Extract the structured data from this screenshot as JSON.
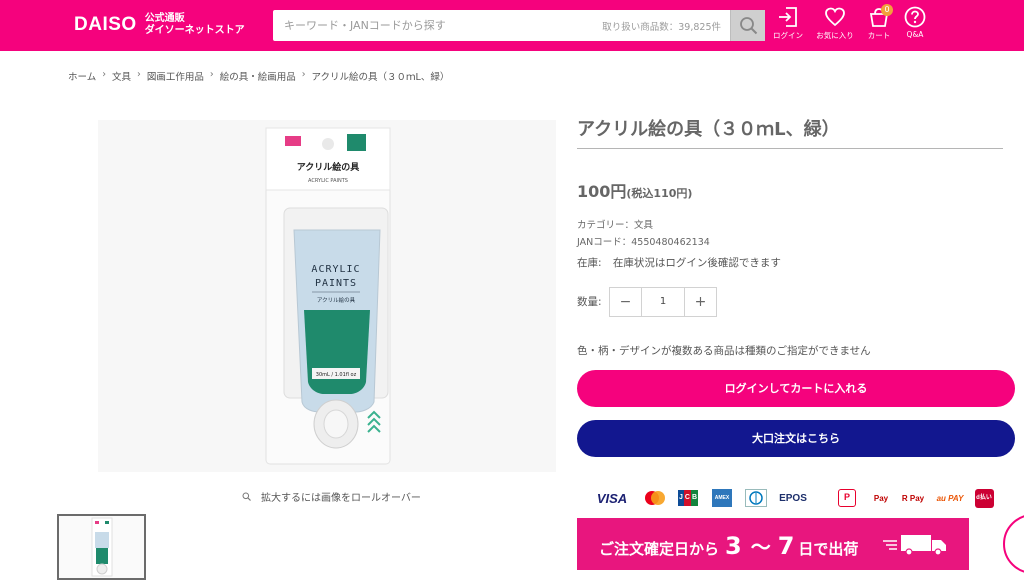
{
  "header": {
    "logo_text": "DAISO",
    "logo_sub_line1": "公式通販",
    "logo_sub_line2": "ダイソーネットストア",
    "search_placeholder": "キーワード・JANコードから探す",
    "search_count": "取り扱い商品数：39,825件",
    "nav": {
      "login": "ログイン",
      "favorites": "お気に入り",
      "cart": "カート",
      "cart_count": "0",
      "qa": "Q&A"
    },
    "brand_color": "#f5027d"
  },
  "breadcrumb": [
    "ホーム",
    "文具",
    "図画工作用品",
    "絵の具・絵画用品",
    "アクリル絵の具（３０ｍL、緑）"
  ],
  "gallery": {
    "zoom_hint": "拡大するには画像をロールオーバー"
  },
  "product": {
    "title": "アクリル絵の具（３０ｍL、緑）",
    "price": "100円",
    "price_tax": "(税込110円)",
    "category": "カテゴリー：文具",
    "jan": "JANコード：4550480462134",
    "stock_label": "在庫:",
    "stock_text": "在庫状況はログイン後確認できます",
    "quantity_label": "数量:",
    "quantity": "1",
    "note": "色・柄・デザインが複数ある商品は種類のご指定ができません",
    "cart_button": "ログインしてカートに入れる",
    "bulk_button": "大口注文はこちら",
    "bulk_color": "#12178f"
  },
  "package": {
    "header_title": "アクリル絵の具",
    "header_sub": "ACRYLIC PAINTS",
    "tube_line1": "ACRYLIC",
    "tube_line2": "PAINTS",
    "tube_jp": "アクリル絵の具",
    "tube_volume": "30mL / 1.01fl oz",
    "paint_color": "#1f8a6c"
  },
  "payments": [
    "VISA",
    "mastercard",
    "JCB",
    "AMEX",
    "Diners",
    "EPOS",
    "PayPay",
    "Pay",
    "R Pay",
    "au PAY",
    "d払い"
  ],
  "banner": {
    "prefix": "ご注文確定日から",
    "num1": "3",
    "tilde": "〜",
    "num2": "7",
    "suffix": "日で出荷"
  }
}
